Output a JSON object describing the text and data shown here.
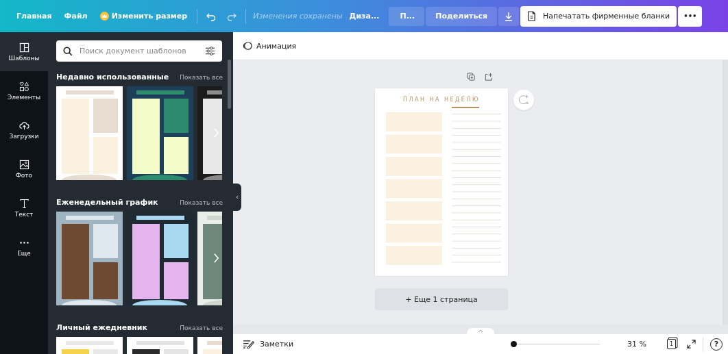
{
  "top_bar": {
    "home": "Главная",
    "file": "Файл",
    "resize": "Изменить размер",
    "save_status": "Изменения сохранены",
    "design_name": "Диза...",
    "pro": "П...",
    "share": "Поделиться",
    "print": "Напечатать фирменные бланки",
    "more": "•••"
  },
  "rail": [
    {
      "kind": "templates",
      "label": "Шаблоны",
      "selected": true
    },
    {
      "kind": "elements",
      "label": "Элементы",
      "selected": false
    },
    {
      "kind": "uploads",
      "label": "Загрузки",
      "selected": false
    },
    {
      "kind": "photos",
      "label": "Фото",
      "selected": false
    },
    {
      "kind": "text",
      "label": "Текст",
      "selected": false
    },
    {
      "kind": "more",
      "label": "Еще",
      "selected": false
    }
  ],
  "search": {
    "placeholder": "Поиск документ шаблонов"
  },
  "sections": [
    {
      "title": "Недавно использованные",
      "show_all": "Показать все",
      "has_next": true,
      "templates": [
        {
          "kind": "plan"
        },
        {
          "kind": "weekly"
        },
        {
          "kind": "dark"
        }
      ]
    },
    {
      "title": "Еженедельный график",
      "show_all": "Показать все",
      "has_next": true,
      "templates": [
        {
          "kind": "cleaning"
        },
        {
          "kind": "stripes"
        },
        {
          "kind": "green"
        }
      ]
    },
    {
      "title": "Личный ежедневник",
      "show_all": "Показать все",
      "templates": [
        {
          "kind": "yellow"
        },
        {
          "kind": "frame"
        },
        {
          "kind": "plan"
        }
      ]
    }
  ],
  "toolbar": {
    "animation": "Анимация"
  },
  "page": {
    "title": "ПЛАН НА НЕДЕЛЮ"
  },
  "add_page": "+ Еще 1 страница",
  "bottom_bar": {
    "notes": "Заметки",
    "zoom": {
      "level": 0.0
    },
    "zoom_reading": "31 %",
    "page_count": "1",
    "help": "?"
  }
}
